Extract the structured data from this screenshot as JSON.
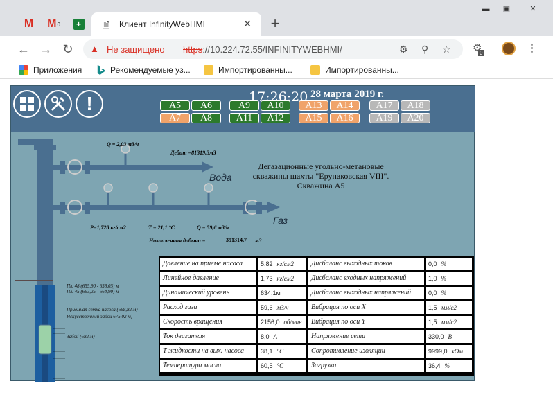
{
  "browser": {
    "tabs": [
      {
        "icon": "gmail-icon"
      },
      {
        "icon": "gmail-icon",
        "badge": "0"
      },
      {
        "icon": "sheets-icon"
      }
    ],
    "active_tab": {
      "title": "Клиент InfinityWebHMI"
    },
    "address": {
      "security_label": "Не защищено",
      "scheme": "https",
      "rest": "://10.224.72.55/INFINITYWEBHMI/"
    },
    "ext_badge": "0",
    "bookmarks": [
      {
        "label": "Приложения",
        "icon": "apps-icon"
      },
      {
        "label": "Рекомендуемые уз...",
        "icon": "bing-icon"
      },
      {
        "label": "Импортированны...",
        "icon": "folder-icon"
      },
      {
        "label": "Импортированны...",
        "icon": "folder-icon"
      }
    ]
  },
  "hmi": {
    "time": "17:26:20",
    "date": "28 марта 2019 г.",
    "wells": [
      {
        "label": "A5",
        "color": "#2c7a2c"
      },
      {
        "label": "A6",
        "color": "#2c7a2c"
      },
      {
        "label": "A9",
        "color": "#2c7a2c"
      },
      {
        "label": "A10",
        "color": "#2c7a2c"
      },
      {
        "label": "A13",
        "color": "#f0a36a"
      },
      {
        "label": "A14",
        "color": "#f0a36a"
      },
      {
        "label": "A17",
        "color": "#b8b8b8"
      },
      {
        "label": "A18",
        "color": "#b8b8b8"
      },
      {
        "label": "A7",
        "color": "#f0a36a"
      },
      {
        "label": "A8",
        "color": "#2c7a2c"
      },
      {
        "label": "A11",
        "color": "#2c7a2c"
      },
      {
        "label": "A12",
        "color": "#2c7a2c"
      },
      {
        "label": "A15",
        "color": "#f0a36a"
      },
      {
        "label": "A16",
        "color": "#f0a36a"
      },
      {
        "label": "A19",
        "color": "#b8b8b8"
      },
      {
        "label": "A20",
        "color": "#b8b8b8"
      }
    ],
    "diagram": {
      "water_q": "Q = 2,03 м3/ч",
      "debit": "Дебит =81319,3м3",
      "water_label": "Вода",
      "gas_label": "Газ",
      "pressure": "P=1,728 кг/см2",
      "temperature": "T = 21,1 °C",
      "gas_q": "Q = 59,6 м3/ч",
      "cumulative_label": "Накопленная добыча =",
      "cumulative_value": "391314,7",
      "cumulative_unit": "м3",
      "title_lines": [
        "Дегазационные угольно-метановые",
        "скважины шахты \"Ерунаковская VIII\".",
        "Скважина A5"
      ],
      "well_labels": [
        "Пл. 48 (655,90 - 658,05) м",
        "Пл. 45 (663,25 - 664,90) м",
        "Приемная сетка насоса (668,82 м)",
        "Искусственный забой 675,02 м)",
        "Забой (682 м)"
      ]
    },
    "table": {
      "left": [
        {
          "label": "Давление на приеме насоса",
          "value": "5,82",
          "unit": "кг/см2"
        },
        {
          "label": "Линейное давление",
          "value": "1,73",
          "unit": "кг/см2"
        },
        {
          "label": "Динамический уровень",
          "value": "634,1м",
          "unit": ""
        },
        {
          "label": "Расход газа",
          "value": "59,6",
          "unit": "м3/ч"
        },
        {
          "label": "Скорость вращения",
          "value": "2156,0",
          "unit": "об/мин"
        },
        {
          "label": "Ток двигателя",
          "value": "8,0",
          "unit": "A"
        },
        {
          "label": "T жидкости на вых. насоса",
          "value": "38,1",
          "unit": "°C"
        },
        {
          "label": "Температура масла",
          "value": "60,5",
          "unit": "°C"
        }
      ],
      "right": [
        {
          "label": "Дисбаланс выходных токов",
          "value": "0,0",
          "unit": "%"
        },
        {
          "label": "Дисбаланс входных напряжений",
          "value": "1,0",
          "unit": "%"
        },
        {
          "label": "Дисбаланс выходных напряжений",
          "value": "0,0",
          "unit": "%"
        },
        {
          "label": "Вибрация по оси X",
          "value": "1,5",
          "unit": "мм/с2"
        },
        {
          "label": "Вибрация по оси Y",
          "value": "1,5",
          "unit": "мм/с2"
        },
        {
          "label": "Напряжение сети",
          "value": "330,0",
          "unit": "B"
        },
        {
          "label": "Сопротивление изоляции",
          "value": "9999,0",
          "unit": "кОм"
        },
        {
          "label": "Загрузка",
          "value": "36,4",
          "unit": "%"
        }
      ]
    }
  }
}
